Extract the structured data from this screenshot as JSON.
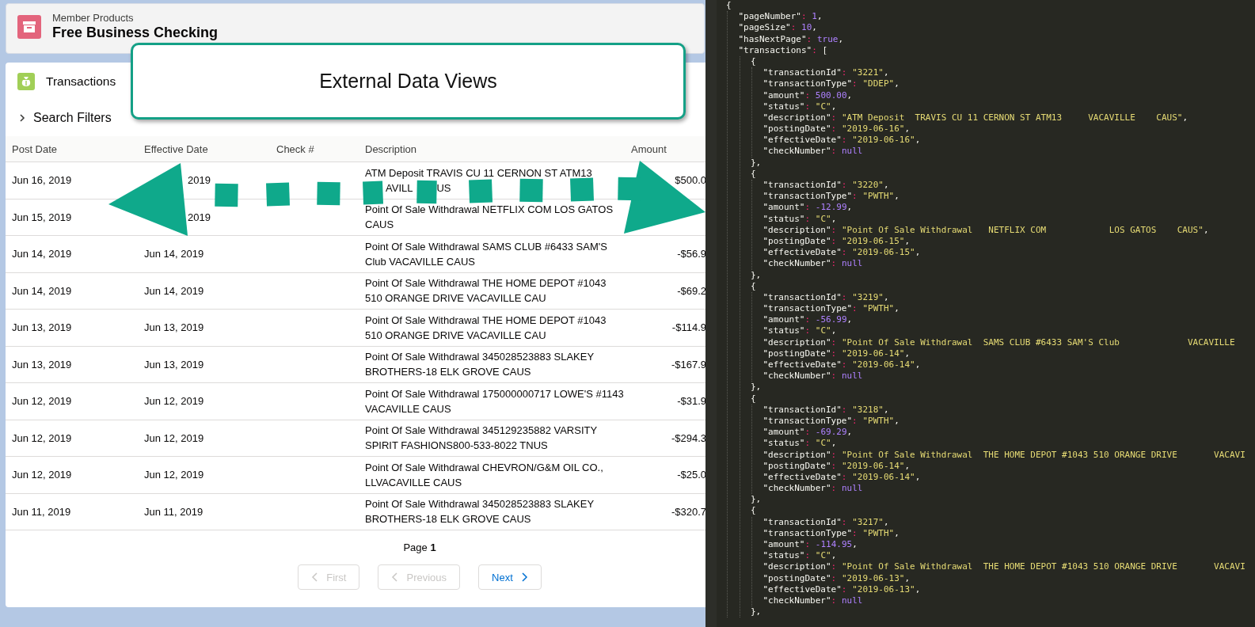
{
  "record_header": {
    "object_label": "Member Products",
    "title": "Free Business Checking"
  },
  "related_list": {
    "title": "Transactions",
    "filters": {
      "label": "Search Filters",
      "expanded": false
    },
    "table": {
      "columns": [
        "Post Date",
        "Effective Date",
        "Check #",
        "Description",
        "Amount"
      ],
      "rows": [
        {
          "post_date": "Jun 16, 2019",
          "effective_date": [
            "2019"
          ],
          "description": "ATM Deposit TRAVIS CU 11 CERNON ST ATM13",
          "description_fragments": [
            "AVILL",
            "US"
          ],
          "amount": "$500.0"
        },
        {
          "post_date": "Jun 15, 2019",
          "effective_date": [
            "2019"
          ],
          "description": "Point Of Sale Withdrawal NETFLIX COM LOS GATOS CAUS"
        },
        {
          "post_date": "Jun 14, 2019",
          "effective_date": [
            "Jun 14, 2019"
          ],
          "description": "Point Of Sale Withdrawal SAMS CLUB #6433 SAM'S Club VACAVILLE CAUS",
          "amount": "-$56.9"
        },
        {
          "post_date": "Jun 14, 2019",
          "effective_date": [
            "Jun 14, 2019"
          ],
          "description": "Point Of Sale Withdrawal THE HOME DEPOT #1043 510 ORANGE DRIVE VACAVILLE CAU",
          "amount": "-$69.2"
        },
        {
          "post_date": "Jun 13, 2019",
          "effective_date": [
            "Jun 13, 2019"
          ],
          "description": "Point Of Sale Withdrawal THE HOME DEPOT #1043 510 ORANGE DRIVE VACAVILLE CAU",
          "amount": "-$114.9"
        },
        {
          "post_date": "Jun 13, 2019",
          "effective_date": [
            "Jun 13, 2019"
          ],
          "description": "Point Of Sale Withdrawal 345028523883 SLAKEY BROTHERS-18 ELK GROVE CAUS",
          "amount": "-$167.9"
        },
        {
          "post_date": "Jun 12, 2019",
          "effective_date": [
            "Jun 12, 2019"
          ],
          "description": "Point Of Sale Withdrawal 175000000717 LOWE'S #1143 VACAVILLE CAUS",
          "amount": "-$31.9"
        },
        {
          "post_date": "Jun 12, 2019",
          "effective_date": [
            "Jun 12, 2019"
          ],
          "description": "Point Of Sale Withdrawal 345129235882 VARSITY SPIRIT FASHIONS800-533-8022 TNUS",
          "amount": "-$294.3"
        },
        {
          "post_date": "Jun 12, 2019",
          "effective_date": [
            "Jun 12, 2019"
          ],
          "description": "Point Of Sale Withdrawal CHEVRON/G&M OIL CO., LLVACAVILLE CAUS",
          "amount": "-$25.0"
        },
        {
          "post_date": "Jun 11, 2019",
          "effective_date": [
            "Jun 11, 2019"
          ],
          "description": "Point Of Sale Withdrawal 345028523883 SLAKEY BROTHERS-18 ELK GROVE CAUS",
          "amount": "-$320.7"
        }
      ]
    },
    "pagination": {
      "page_label": "Page",
      "page_number": "1",
      "buttons": [
        {
          "label": "First",
          "kind": "back",
          "disabled": true
        },
        {
          "label": "Previous",
          "kind": "back",
          "disabled": true
        },
        {
          "label": "Next",
          "kind": "forward",
          "disabled": false
        }
      ]
    }
  },
  "callout": {
    "text": "External Data Views"
  },
  "editor": {
    "lines": [
      {
        "value": "{",
        "kind": "punct",
        "children": [
          {
            "key": "\"pageNumber\"",
            "sep": ":",
            "value": "1",
            "kind": "number",
            "end": ","
          },
          {
            "key": "\"pageSize\"",
            "sep": ":",
            "value": "10",
            "kind": "number",
            "end": ","
          },
          {
            "key": "\"hasNextPage\"",
            "sep": ":",
            "value": "true",
            "kind": "constant",
            "end": ","
          },
          {
            "key": "\"transactions\"",
            "sep": ":",
            "value": "[",
            "kind": "punct",
            "children": [
              {
                "value": "{",
                "kind": "punct",
                "children": [
                  {
                    "key": "\"transactionId\"",
                    "sep": ":",
                    "value": "\"3221\"",
                    "kind": "string",
                    "end": ","
                  },
                  {
                    "key": "\"transactionType\"",
                    "sep": ":",
                    "value": "\"DDEP\"",
                    "kind": "string",
                    "end": ","
                  },
                  {
                    "key": "\"amount\"",
                    "sep": ":",
                    "value": "500.00",
                    "kind": "number",
                    "end": ","
                  },
                  {
                    "key": "\"status\"",
                    "sep": ":",
                    "value": "\"C\"",
                    "kind": "string",
                    "end": ","
                  },
                  {
                    "key": "\"description\"",
                    "sep": ":",
                    "value": "\"ATM Deposit  TRAVIS CU 11 CERNON ST ATM13     VACAVILLE    CAUS\"",
                    "kind": "string",
                    "end": ","
                  },
                  {
                    "key": "\"postingDate\"",
                    "sep": ":",
                    "value": "\"2019-06-16\"",
                    "kind": "string",
                    "end": ","
                  },
                  {
                    "key": "\"effectiveDate\"",
                    "sep": ":",
                    "value": "\"2019-06-16\"",
                    "kind": "string",
                    "end": ","
                  },
                  {
                    "key": "\"checkNumber\"",
                    "sep": ":",
                    "value": "null",
                    "kind": "constant"
                  }
                ]
              },
              {
                "value": "},",
                "kind": "punct"
              },
              {
                "value": "{",
                "kind": "punct",
                "children": [
                  {
                    "key": "\"transactionId\"",
                    "sep": ":",
                    "value": "\"3220\"",
                    "kind": "string",
                    "end": ","
                  },
                  {
                    "key": "\"transactionType\"",
                    "sep": ":",
                    "value": "\"PWTH\"",
                    "kind": "string",
                    "end": ","
                  },
                  {
                    "key": "\"amount\"",
                    "sep": ":",
                    "value": "-12.99",
                    "kind": "number",
                    "end": ","
                  },
                  {
                    "key": "\"status\"",
                    "sep": ":",
                    "value": "\"C\"",
                    "kind": "string",
                    "end": ","
                  },
                  {
                    "key": "\"description\"",
                    "sep": ":",
                    "value": "\"Point Of Sale Withdrawal   NETFLIX COM            LOS GATOS    CAUS\"",
                    "kind": "string",
                    "end": ","
                  },
                  {
                    "key": "\"postingDate\"",
                    "sep": ":",
                    "value": "\"2019-06-15\"",
                    "kind": "string",
                    "end": ","
                  },
                  {
                    "key": "\"effectiveDate\"",
                    "sep": ":",
                    "value": "\"2019-06-15\"",
                    "kind": "string",
                    "end": ","
                  },
                  {
                    "key": "\"checkNumber\"",
                    "sep": ":",
                    "value": "null",
                    "kind": "constant"
                  }
                ]
              },
              {
                "value": "},",
                "kind": "punct"
              },
              {
                "value": "{",
                "kind": "punct",
                "children": [
                  {
                    "key": "\"transactionId\"",
                    "sep": ":",
                    "value": "\"3219\"",
                    "kind": "string",
                    "end": ","
                  },
                  {
                    "key": "\"transactionType\"",
                    "sep": ":",
                    "value": "\"PWTH\"",
                    "kind": "string",
                    "end": ","
                  },
                  {
                    "key": "\"amount\"",
                    "sep": ":",
                    "value": "-56.99",
                    "kind": "number",
                    "end": ","
                  },
                  {
                    "key": "\"status\"",
                    "sep": ":",
                    "value": "\"C\"",
                    "kind": "string",
                    "end": ","
                  },
                  {
                    "key": "\"description\"",
                    "sep": ":",
                    "value": "\"Point Of Sale Withdrawal  SAMS CLUB #6433 SAM'S Club             VACAVILLE",
                    "kind": "string"
                  },
                  {
                    "key": "\"postingDate\"",
                    "sep": ":",
                    "value": "\"2019-06-14\"",
                    "kind": "string",
                    "end": ","
                  },
                  {
                    "key": "\"effectiveDate\"",
                    "sep": ":",
                    "value": "\"2019-06-14\"",
                    "kind": "string",
                    "end": ","
                  },
                  {
                    "key": "\"checkNumber\"",
                    "sep": ":",
                    "value": "null",
                    "kind": "constant"
                  }
                ]
              },
              {
                "value": "},",
                "kind": "punct"
              },
              {
                "value": "{",
                "kind": "punct",
                "children": [
                  {
                    "key": "\"transactionId\"",
                    "sep": ":",
                    "value": "\"3218\"",
                    "kind": "string",
                    "end": ","
                  },
                  {
                    "key": "\"transactionType\"",
                    "sep": ":",
                    "value": "\"PWTH\"",
                    "kind": "string",
                    "end": ","
                  },
                  {
                    "key": "\"amount\"",
                    "sep": ":",
                    "value": "-69.29",
                    "kind": "number",
                    "end": ","
                  },
                  {
                    "key": "\"status\"",
                    "sep": ":",
                    "value": "\"C\"",
                    "kind": "string",
                    "end": ","
                  },
                  {
                    "key": "\"description\"",
                    "sep": ":",
                    "value": "\"Point Of Sale Withdrawal  THE HOME DEPOT #1043 510 ORANGE DRIVE       VACAVI",
                    "kind": "string"
                  },
                  {
                    "key": "\"postingDate\"",
                    "sep": ":",
                    "value": "\"2019-06-14\"",
                    "kind": "string",
                    "end": ","
                  },
                  {
                    "key": "\"effectiveDate\"",
                    "sep": ":",
                    "value": "\"2019-06-14\"",
                    "kind": "string",
                    "end": ","
                  },
                  {
                    "key": "\"checkNumber\"",
                    "sep": ":",
                    "value": "null",
                    "kind": "constant"
                  }
                ]
              },
              {
                "value": "},",
                "kind": "punct"
              },
              {
                "value": "{",
                "kind": "punct",
                "children": [
                  {
                    "key": "\"transactionId\"",
                    "sep": ":",
                    "value": "\"3217\"",
                    "kind": "string",
                    "end": ","
                  },
                  {
                    "key": "\"transactionType\"",
                    "sep": ":",
                    "value": "\"PWTH\"",
                    "kind": "string",
                    "end": ","
                  },
                  {
                    "key": "\"amount\"",
                    "sep": ":",
                    "value": "-114.95",
                    "kind": "number",
                    "end": ","
                  },
                  {
                    "key": "\"status\"",
                    "sep": ":",
                    "value": "\"C\"",
                    "kind": "string",
                    "end": ","
                  },
                  {
                    "key": "\"description\"",
                    "sep": ":",
                    "value": "\"Point Of Sale Withdrawal  THE HOME DEPOT #1043 510 ORANGE DRIVE       VACAVI",
                    "kind": "string"
                  },
                  {
                    "key": "\"postingDate\"",
                    "sep": ":",
                    "value": "\"2019-06-13\"",
                    "kind": "string",
                    "end": ","
                  },
                  {
                    "key": "\"effectiveDate\"",
                    "sep": ":",
                    "value": "\"2019-06-13\"",
                    "kind": "string",
                    "end": ","
                  },
                  {
                    "key": "\"checkNumber\"",
                    "sep": ":",
                    "value": "null",
                    "kind": "constant"
                  }
                ]
              },
              {
                "value": "},",
                "kind": "punct"
              }
            ]
          }
        ]
      }
    ]
  }
}
